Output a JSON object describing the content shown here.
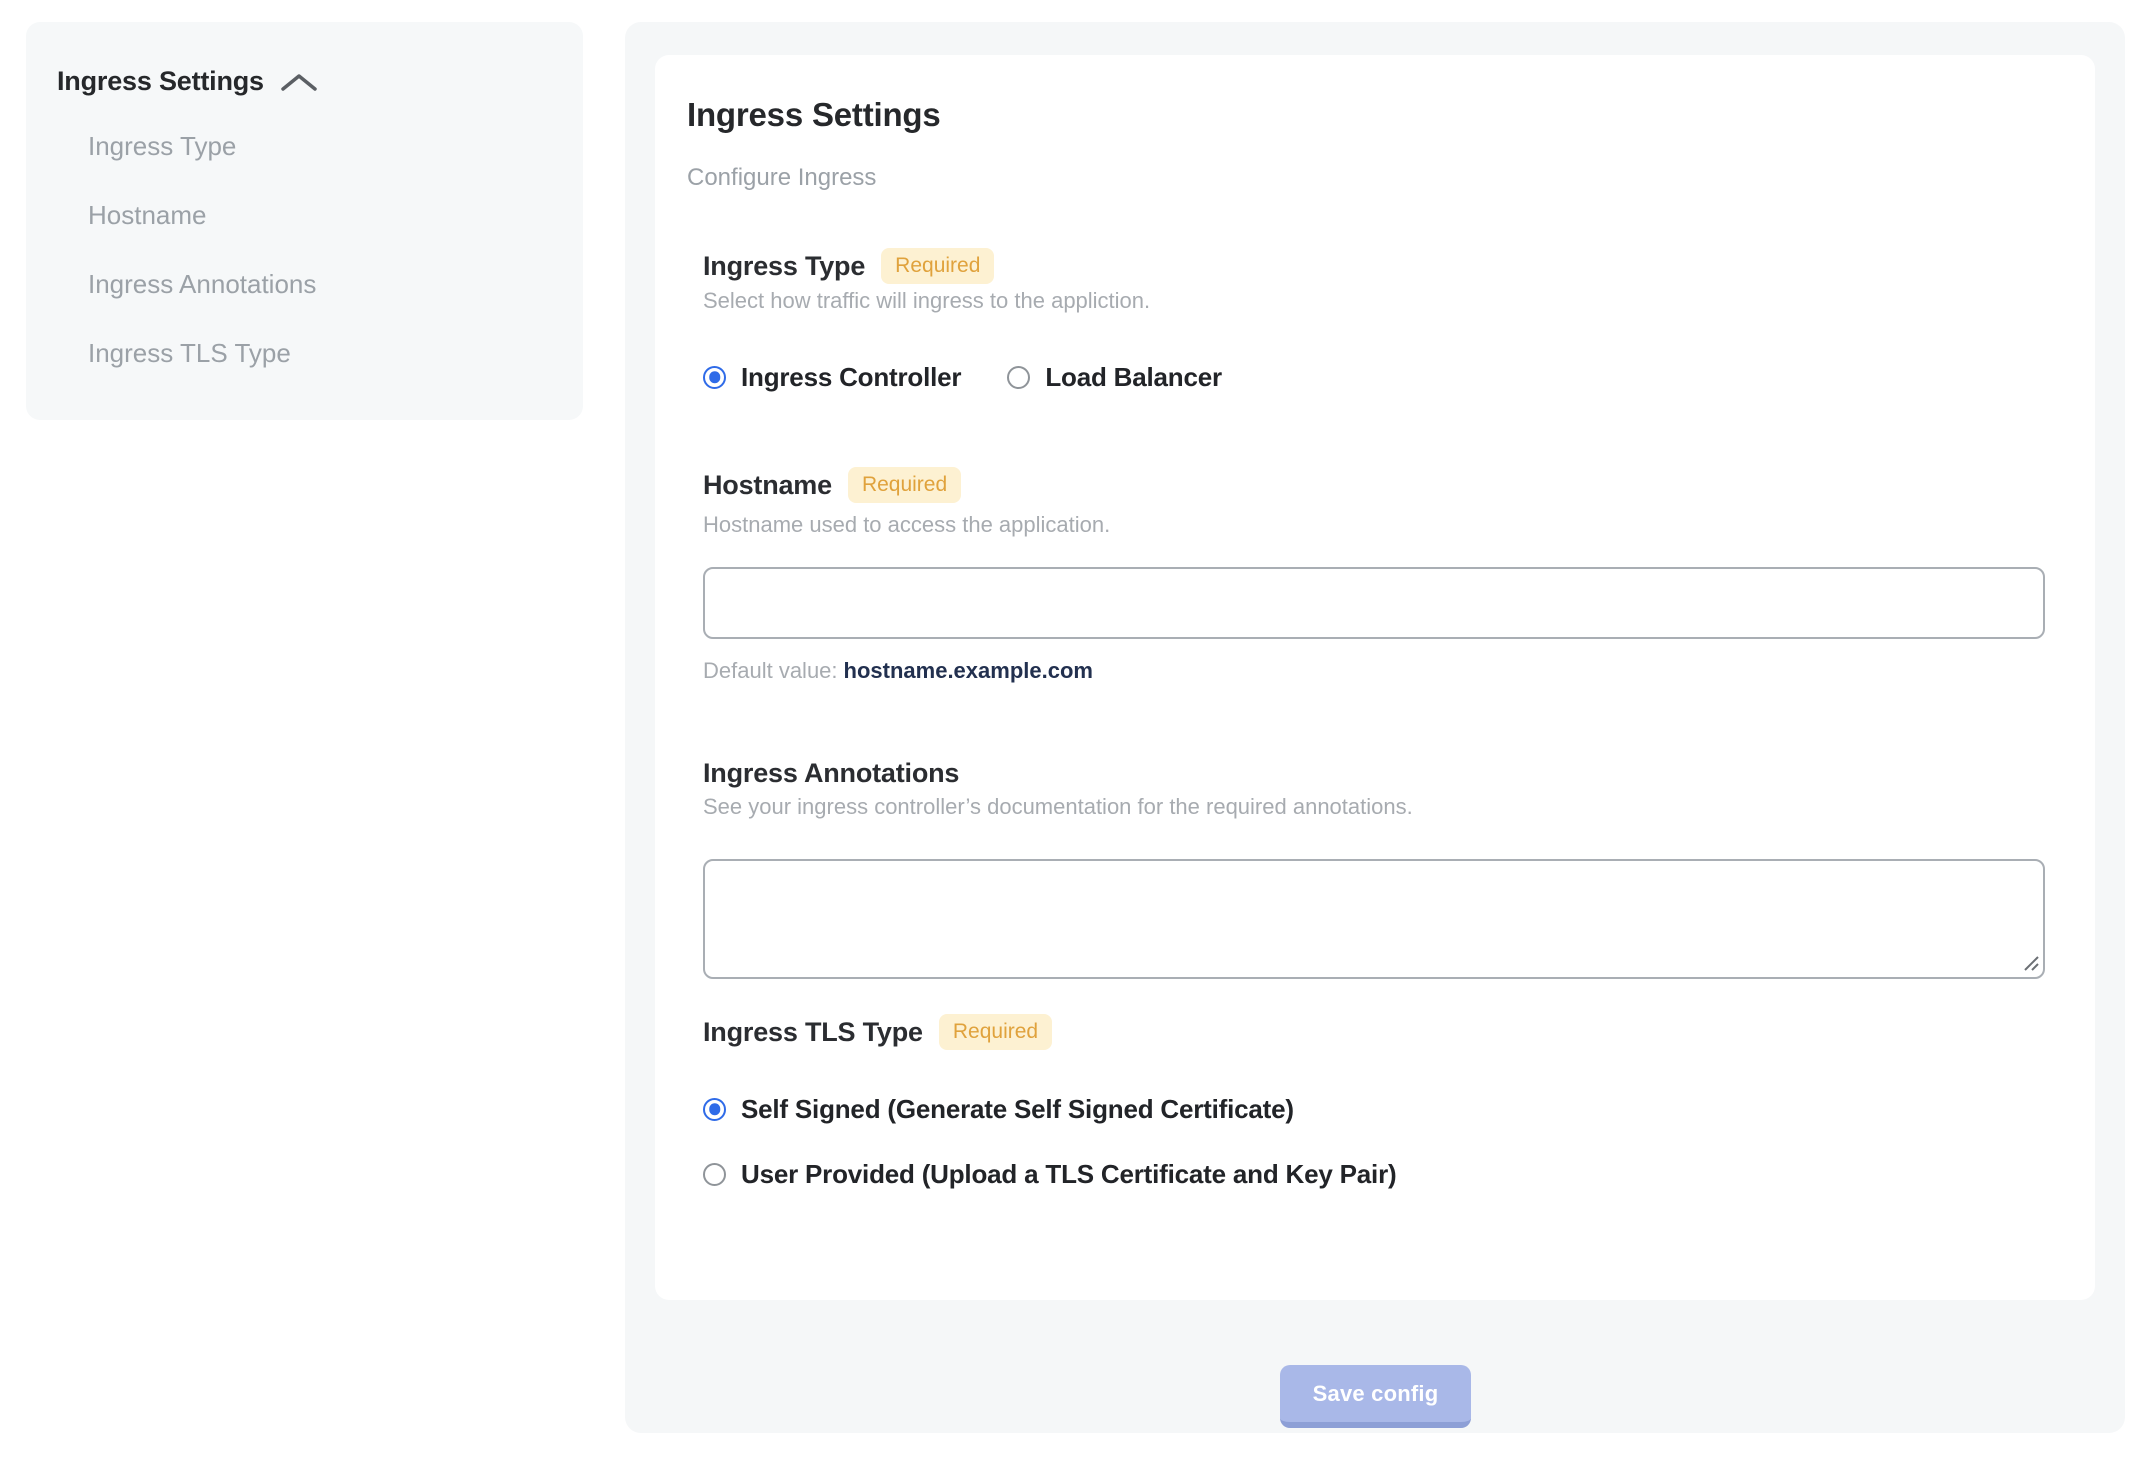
{
  "sidebar": {
    "header": "Ingress Settings",
    "items": [
      {
        "label": "Ingress Type"
      },
      {
        "label": "Hostname"
      },
      {
        "label": "Ingress Annotations"
      },
      {
        "label": "Ingress TLS Type"
      }
    ]
  },
  "main": {
    "title": "Ingress Settings",
    "subtitle": "Configure Ingress",
    "required_badge": "Required",
    "sections": {
      "ingress_type": {
        "label": "Ingress Type",
        "required": true,
        "description": "Select how traffic will ingress to the appliction.",
        "options": [
          {
            "label": "Ingress Controller",
            "selected": true
          },
          {
            "label": "Load Balancer",
            "selected": false
          }
        ]
      },
      "hostname": {
        "label": "Hostname",
        "required": true,
        "description": "Hostname used to access the application.",
        "input_value": "",
        "default_value_label": "Default value:",
        "default_value": "hostname.example.com"
      },
      "ingress_annotations": {
        "label": "Ingress Annotations",
        "required": false,
        "description": "See your ingress controller’s documentation for the required annotations.",
        "textarea_value": ""
      },
      "ingress_tls_type": {
        "label": "Ingress TLS Type",
        "required": true,
        "options": [
          {
            "label": "Self Signed (Generate Self Signed Certificate)",
            "selected": true
          },
          {
            "label": "User Provided (Upload a TLS Certificate and Key Pair)",
            "selected": false
          }
        ]
      }
    },
    "save_button": "Save config"
  },
  "colors": {
    "accent_blue": "#2f6be8",
    "badge_bg": "#fdf1d2",
    "badge_text": "#e0a23c",
    "default_value_text": "#22304f",
    "panel_bg": "#f5f7f8",
    "save_button_bg": "#a9b8e8"
  }
}
